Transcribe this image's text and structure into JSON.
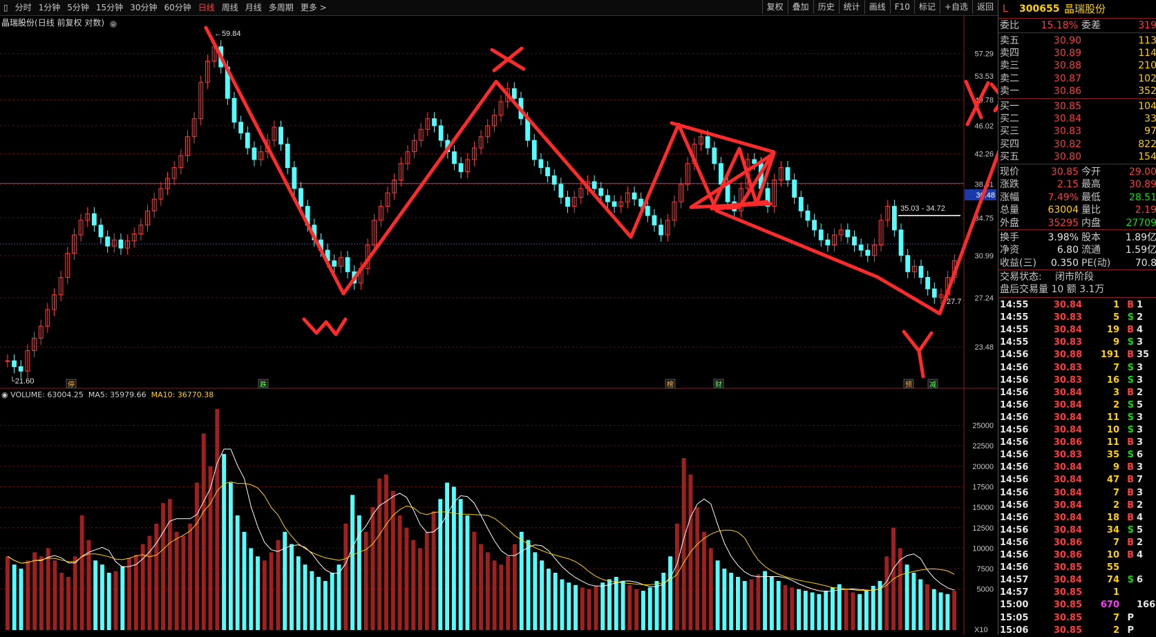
{
  "toolbar": {
    "periods": [
      "分时",
      "1分钟",
      "5分钟",
      "15分钟",
      "30分钟",
      "60分钟",
      "日线",
      "周线",
      "月线",
      "多周期",
      "更多 >"
    ],
    "active": "日线",
    "right_buttons": [
      "复权",
      "叠加",
      "历史",
      "统计",
      "画线",
      "F10",
      "标记",
      "+自选",
      "返回"
    ]
  },
  "title": {
    "stock": "晶瑞股份",
    "mode": "(日线 前复权 对数)"
  },
  "chart_data": {
    "type": "candlestick",
    "scale": "log",
    "y_ticks": [
      "57.29",
      "53.53",
      "49.78",
      "46.02",
      "42.26",
      "38.51",
      "34.75",
      "30.99",
      "27.24",
      "23.48"
    ],
    "high_label": "59.84",
    "low_label": "21.60",
    "range_label": "35.03 - 34.72",
    "current_price_tag": "36.48",
    "last_label": "27.7",
    "event_markers": [
      "停",
      "跌",
      "榜",
      "财",
      "预",
      "减"
    ],
    "close": [
      22.5,
      22.1,
      21.8,
      23.2,
      24.1,
      25.0,
      26.3,
      27.5,
      29.0,
      31.2,
      33.0,
      34.5,
      35.2,
      34.0,
      32.8,
      31.9,
      32.5,
      31.7,
      32.4,
      33.1,
      34.0,
      35.5,
      36.8,
      38.0,
      39.2,
      40.5,
      42.0,
      44.5,
      47.0,
      52.5,
      56.0,
      58.5,
      55.0,
      50.0,
      46.5,
      45.0,
      43.0,
      41.5,
      42.5,
      44.0,
      45.8,
      43.5,
      40.5,
      38.0,
      36.0,
      34.0,
      32.5,
      31.5,
      30.5,
      30.0,
      30.8,
      29.5,
      28.5,
      29.8,
      32.0,
      34.5,
      36.0,
      37.5,
      39.0,
      41.0,
      42.5,
      44.0,
      45.5,
      47.0,
      46.0,
      44.0,
      42.5,
      41.0,
      40.0,
      41.5,
      43.0,
      44.5,
      46.0,
      47.5,
      49.5,
      51.5,
      50.0,
      47.0,
      44.0,
      41.5,
      40.5,
      39.5,
      38.5,
      37.0,
      36.0,
      37.0,
      38.0,
      38.8,
      38.0,
      37.2,
      36.5,
      36.0,
      36.5,
      37.5,
      36.8,
      36.0,
      35.0,
      34.0,
      33.0,
      34.5,
      36.5,
      38.5,
      41.0,
      43.5,
      44.5,
      43.0,
      41.0,
      38.5,
      36.5,
      35.5,
      38.0,
      41.5,
      41.0,
      38.0,
      36.0,
      39.0,
      40.5,
      39.0,
      37.0,
      35.5,
      34.5,
      33.5,
      32.5,
      32.0,
      33.0,
      33.5,
      32.8,
      32.0,
      31.5,
      31.0,
      32.0,
      34.5,
      36.0,
      33.5,
      31.0,
      29.5,
      30.0,
      29.0,
      28.0,
      27.3,
      27.5,
      29.0,
      30.5
    ],
    "volume_ticks": [
      "25000",
      "22500",
      "20000",
      "17500",
      "15000",
      "12500",
      "10000",
      "7500",
      "5000"
    ],
    "volume": 63004.25,
    "ma5": 35979.66,
    "ma10": 36770.38,
    "volume_multiplier": "X10",
    "volume_bars": [
      9000,
      8000,
      7500,
      8500,
      9500,
      9000,
      10000,
      8500,
      7000,
      6500,
      9000,
      14000,
      11000,
      8500,
      8000,
      7000,
      7200,
      7800,
      8800,
      9200,
      10500,
      11500,
      13000,
      15500,
      16000,
      12000,
      11500,
      13000,
      18000,
      24000,
      20000,
      27000,
      21500,
      18000,
      14000,
      12000,
      10000,
      9000,
      8500,
      9500,
      11000,
      12000,
      10500,
      9000,
      8000,
      7200,
      6500,
      6000,
      7000,
      8000,
      13000,
      16500,
      14000,
      12000,
      15000,
      18500,
      19000,
      17000,
      14000,
      12500,
      11000,
      10000,
      12000,
      14500,
      16000,
      18000,
      17500,
      16000,
      14000,
      12000,
      10500,
      9500,
      8500,
      8000,
      9000,
      10500,
      12000,
      11000,
      9500,
      8500,
      7500,
      7000,
      6200,
      5800,
      5500,
      5200,
      5000,
      5400,
      5800,
      6200,
      6500,
      6000,
      5500,
      5000,
      4800,
      5200,
      6000,
      7000,
      9000,
      13000,
      21000,
      19000,
      15000,
      12000,
      10000,
      8500,
      7500,
      7000,
      6500,
      6000,
      6200,
      6800,
      7200,
      6500,
      6000,
      5500,
      5200,
      5000,
      4800,
      4600,
      4400,
      4800,
      5200,
      5600,
      5000,
      4600,
      4400,
      4800,
      5400,
      6000,
      9000,
      12500,
      10000,
      8000,
      7000,
      6200,
      5600,
      5000,
      4600,
      4400,
      4800
    ]
  },
  "annotations": {
    "w": "W",
    "x": "X",
    "y": "Y",
    "xx": "XX"
  },
  "quote": {
    "market_flag": "L",
    "code": "300655",
    "name": "晶瑞股份",
    "weibi_label": "委比",
    "weibi": "15.18%",
    "weicha_label": "委差",
    "weicha": "319",
    "asks": [
      {
        "label": "卖五",
        "price": "30.90",
        "vol": "113"
      },
      {
        "label": "卖四",
        "price": "30.89",
        "vol": "114"
      },
      {
        "label": "卖三",
        "price": "30.88",
        "vol": "210"
      },
      {
        "label": "卖二",
        "price": "30.87",
        "vol": "102"
      },
      {
        "label": "卖一",
        "price": "30.86",
        "vol": "352"
      }
    ],
    "bids": [
      {
        "label": "买一",
        "price": "30.85",
        "vol": "104"
      },
      {
        "label": "买二",
        "price": "30.84",
        "vol": "33"
      },
      {
        "label": "买三",
        "price": "30.83",
        "vol": "97"
      },
      {
        "label": "买四",
        "price": "30.82",
        "vol": "822"
      },
      {
        "label": "买五",
        "price": "30.80",
        "vol": "154"
      }
    ],
    "stats": [
      {
        "l1": "现价",
        "v1": "30.85",
        "c1": "red",
        "l2": "今开",
        "v2": "29.00",
        "c2": "red"
      },
      {
        "l1": "涨跌",
        "v1": "2.15",
        "c1": "red",
        "l2": "最高",
        "v2": "30.89",
        "c2": "red"
      },
      {
        "l1": "涨幅",
        "v1": "7.49%",
        "c1": "red",
        "l2": "最低",
        "v2": "28.51",
        "c2": "grn"
      },
      {
        "l1": "总量",
        "v1": "63004",
        "c1": "yel",
        "l2": "量比",
        "v2": "2.19",
        "c2": "red"
      },
      {
        "l1": "外盘",
        "v1": "35295",
        "c1": "red",
        "l2": "内盘",
        "v2": "27709",
        "c2": "grn"
      }
    ],
    "stats2": [
      {
        "l1": "换手",
        "v1": "3.98%",
        "l2": "股本",
        "v2": "1.89亿"
      },
      {
        "l1": "净资",
        "v1": "6.80",
        "l2": "流通",
        "v2": "1.59亿"
      },
      {
        "l1": "收益(三)",
        "v1": "0.350",
        "l2": "PE(动)",
        "v2": "70.8"
      }
    ],
    "status_label": "交易状态:",
    "status": "闭市阶段",
    "after_hours": "盘后交易量 10 额 3.1万",
    "ticks": [
      {
        "t": "14:55",
        "p": "30.84",
        "v": "1",
        "s": "B",
        "c": "red",
        "n": "1"
      },
      {
        "t": "14:55",
        "p": "30.83",
        "v": "5",
        "s": "S",
        "c": "grn",
        "n": "2"
      },
      {
        "t": "14:55",
        "p": "30.84",
        "v": "19",
        "s": "B",
        "c": "red",
        "n": "4"
      },
      {
        "t": "14:55",
        "p": "30.83",
        "v": "9",
        "s": "S",
        "c": "grn",
        "n": "3"
      },
      {
        "t": "14:56",
        "p": "30.88",
        "v": "191",
        "s": "B",
        "c": "red",
        "n": "35"
      },
      {
        "t": "14:56",
        "p": "30.83",
        "v": "7",
        "s": "S",
        "c": "grn",
        "n": "3"
      },
      {
        "t": "14:56",
        "p": "30.83",
        "v": "16",
        "s": "S",
        "c": "grn",
        "n": "3"
      },
      {
        "t": "14:56",
        "p": "30.84",
        "v": "3",
        "s": "B",
        "c": "red",
        "n": "2"
      },
      {
        "t": "14:56",
        "p": "30.84",
        "v": "2",
        "s": "S",
        "c": "grn",
        "n": "5"
      },
      {
        "t": "14:56",
        "p": "30.84",
        "v": "11",
        "s": "S",
        "c": "grn",
        "n": "3"
      },
      {
        "t": "14:56",
        "p": "30.84",
        "v": "10",
        "s": "S",
        "c": "grn",
        "n": "3"
      },
      {
        "t": "14:56",
        "p": "30.86",
        "v": "11",
        "s": "B",
        "c": "red",
        "n": "3"
      },
      {
        "t": "14:56",
        "p": "30.83",
        "v": "35",
        "s": "S",
        "c": "grn",
        "n": "6"
      },
      {
        "t": "14:56",
        "p": "30.84",
        "v": "9",
        "s": "B",
        "c": "red",
        "n": "3"
      },
      {
        "t": "14:56",
        "p": "30.84",
        "v": "47",
        "s": "B",
        "c": "red",
        "n": "7"
      },
      {
        "t": "14:56",
        "p": "30.84",
        "v": "7",
        "s": "B",
        "c": "red",
        "n": "3"
      },
      {
        "t": "14:56",
        "p": "30.84",
        "v": "2",
        "s": "B",
        "c": "red",
        "n": "2"
      },
      {
        "t": "14:56",
        "p": "30.84",
        "v": "18",
        "s": "B",
        "c": "red",
        "n": "4"
      },
      {
        "t": "14:56",
        "p": "30.84",
        "v": "34",
        "s": "S",
        "c": "grn",
        "n": "5"
      },
      {
        "t": "14:56",
        "p": "30.86",
        "v": "7",
        "s": "B",
        "c": "red",
        "n": "2"
      },
      {
        "t": "14:56",
        "p": "30.86",
        "v": "10",
        "s": "B",
        "c": "red",
        "n": "4"
      },
      {
        "t": "14:56",
        "p": "30.85",
        "v": "55",
        "s": "",
        "c": "red",
        "n": ""
      },
      {
        "t": "14:57",
        "p": "30.84",
        "v": "74",
        "s": "S",
        "c": "grn",
        "n": "6"
      },
      {
        "t": "14:57",
        "p": "30.85",
        "v": "1",
        "s": "",
        "c": "red",
        "n": ""
      },
      {
        "t": "15:00",
        "p": "30.85",
        "v": "670",
        "s": "",
        "c": "mag",
        "n": "166"
      },
      {
        "t": "15:05",
        "p": "30.85",
        "v": "7",
        "s": "P",
        "c": "red",
        "n": ""
      },
      {
        "t": "15:06",
        "p": "30.85",
        "v": "2",
        "s": "P",
        "c": "red",
        "n": ""
      }
    ]
  },
  "colors": {
    "up": "#ff3b3b",
    "down": "#54ffff",
    "pen": "#ff2a2a",
    "ma5": "#ffffff",
    "ma10": "#ffd200"
  }
}
